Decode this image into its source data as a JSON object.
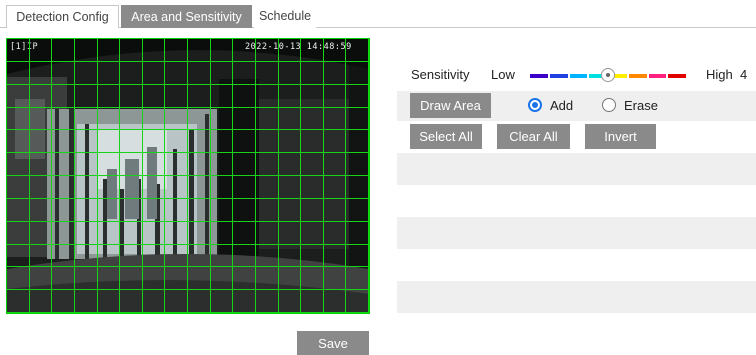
{
  "tabs": [
    {
      "label": "Detection Config",
      "active": false
    },
    {
      "label": "Area and Sensitivity",
      "active": true
    },
    {
      "label": "Schedule",
      "active": false
    }
  ],
  "video": {
    "channel_label": "[1]IP",
    "timestamp": "2022-10-13 14:48:59",
    "grid": {
      "columns": 16,
      "rows": 12,
      "line_color": "#18d418"
    }
  },
  "sensitivity": {
    "label": "Sensitivity",
    "low_label": "Low",
    "high_label": "High",
    "value": "4",
    "level": 4,
    "max": 8,
    "colors": [
      "#3a00c8",
      "#2040e0",
      "#00b4ff",
      "#00e0e0",
      "#ffee00",
      "#ff8800",
      "#ff2080",
      "#e00000"
    ]
  },
  "area": {
    "draw_button": "Draw Area",
    "add_label": "Add",
    "erase_label": "Erase",
    "selected": "add"
  },
  "actions": {
    "select_all": "Select All",
    "clear_all": "Clear All",
    "invert": "Invert"
  },
  "save_label": "Save",
  "accent_color": "#1a73e8",
  "button_color": "#8a8a8a"
}
